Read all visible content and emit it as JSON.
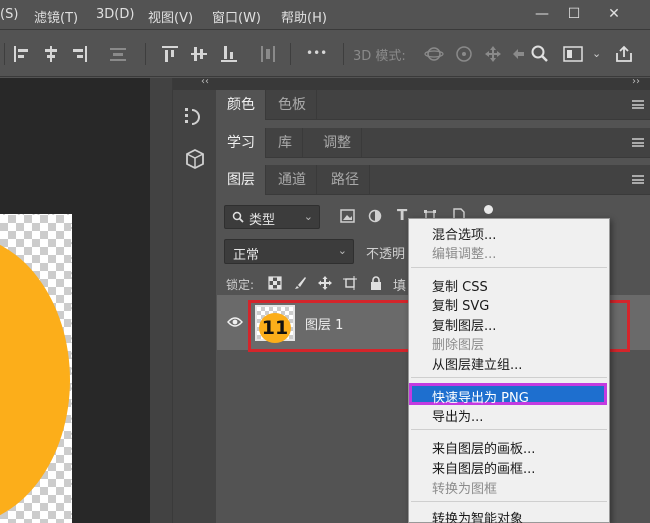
{
  "menubar": {
    "items": [
      "(S)",
      "滤镜(T)",
      "3D(D)",
      "视图(V)",
      "窗口(W)",
      "帮助(H)"
    ],
    "minimize": "—",
    "restore": "☐",
    "close": "✕"
  },
  "options_bar": {
    "more": "•••",
    "mode_3d_label": "3D 模式:"
  },
  "panels": {
    "collapse_arrows": "‹‹",
    "expand_arrows": "››",
    "row1_tabs": [
      "颜色",
      "色板"
    ],
    "row2_tabs": [
      "学习",
      "库",
      "调整"
    ],
    "row3_tabs": [
      "图层",
      "通道",
      "路径"
    ]
  },
  "layers": {
    "filter_label": "类型",
    "blend_mode": "正常",
    "opacity_label": "不透明",
    "lock_label": "锁定:",
    "fill_label": "填",
    "layer_name": "图层 1"
  },
  "step_badge": "11",
  "context_menu": {
    "items": [
      {
        "label": "混合选项...",
        "disabled": false
      },
      {
        "label": "编辑调整...",
        "disabled": true
      },
      {
        "label": "复制 CSS",
        "disabled": false
      },
      {
        "label": "复制 SVG",
        "disabled": false
      },
      {
        "label": "复制图层...",
        "disabled": false
      },
      {
        "label": "删除图层",
        "disabled": true
      },
      {
        "label": "从图层建立组...",
        "disabled": false
      },
      {
        "label": "快速导出为 PNG",
        "disabled": false,
        "highlighted": true
      },
      {
        "label": "导出为...",
        "disabled": false
      },
      {
        "label": "来自图层的画板...",
        "disabled": false
      },
      {
        "label": "来自图层的画框...",
        "disabled": false
      },
      {
        "label": "转换为图框",
        "disabled": true
      },
      {
        "label": "转换为智能对象",
        "disabled": false
      }
    ]
  },
  "colors": {
    "highlight_border": "#d4252b",
    "menu_highlight": "#1e6fcf",
    "menu_highlight_border": "#c33be0",
    "badge": "#fcae1a"
  }
}
